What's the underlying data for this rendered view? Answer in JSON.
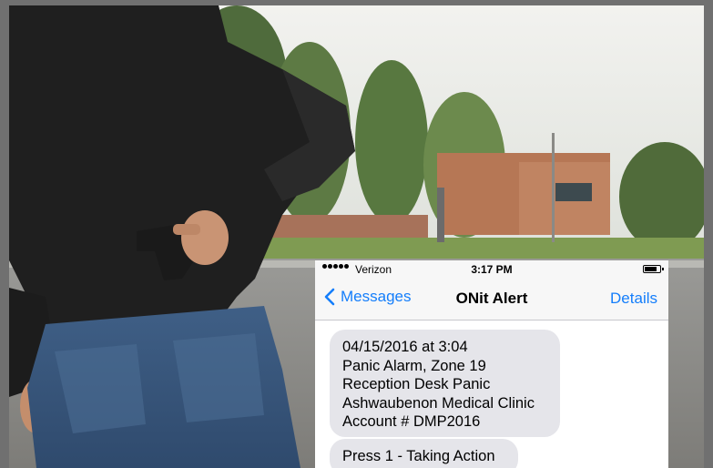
{
  "status_bar": {
    "carrier": "Verizon",
    "time": "3:17 PM"
  },
  "nav": {
    "back_label": "Messages",
    "title": "ONit Alert",
    "details_label": "Details"
  },
  "messages": [
    {
      "lines": [
        "04/15/2016 at 3:04",
        "Panic Alarm, Zone 19",
        "Reception Desk Panic",
        "Ashwaubenon Medical Clinic",
        "Account # DMP2016"
      ]
    },
    {
      "lines": [
        "Press 1 - Taking Action"
      ]
    }
  ],
  "colors": {
    "ios_blue": "#147efb",
    "bubble_gray": "#e5e5ea",
    "bar_gray": "#f7f7f7"
  },
  "icons": {
    "back": "chevron-left-icon",
    "battery": "battery-icon",
    "signal": "signal-dots-icon"
  }
}
